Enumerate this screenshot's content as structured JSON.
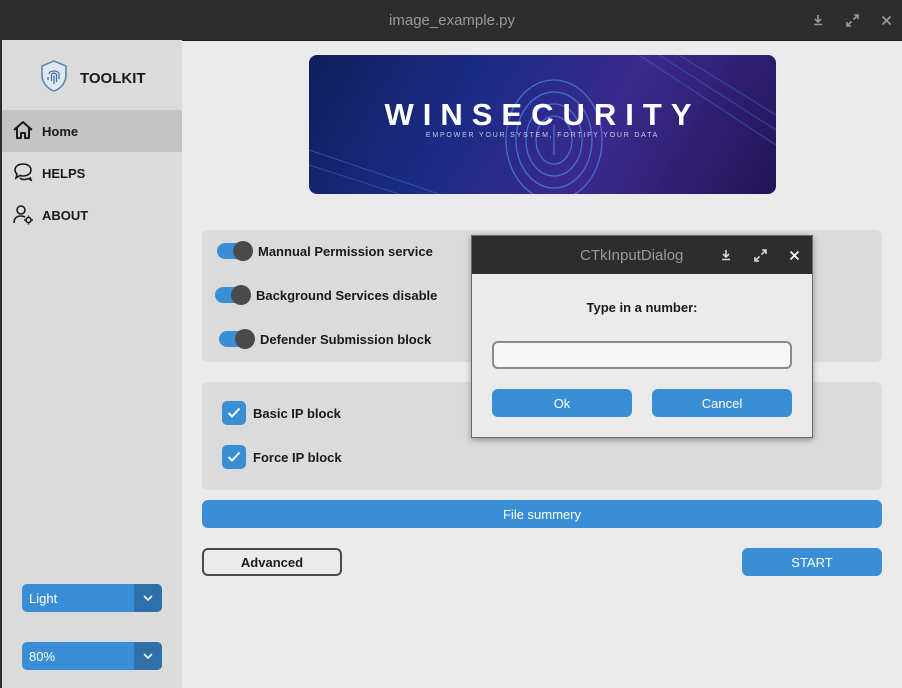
{
  "window": {
    "title": "image_example.py",
    "controls": [
      "minimize-icon",
      "maximize-icon",
      "close-icon"
    ]
  },
  "sidebar": {
    "logo_text": "TOOLKIT",
    "items": [
      {
        "label": "Home",
        "icon": "home-icon",
        "active": true
      },
      {
        "label": "HELPS",
        "icon": "chat-icon",
        "active": false
      },
      {
        "label": "ABOUT",
        "icon": "user-gear-icon",
        "active": false
      }
    ],
    "appearance_mode": "Light",
    "scaling": "80%"
  },
  "banner": {
    "title": "WINSECURITY",
    "subtitle": "EMPOWER YOUR SYSTEM, FORTIFY YOUR DATA"
  },
  "switches": [
    {
      "label": "Mannual Permission service",
      "on": true
    },
    {
      "label": "Background Services disable",
      "on": true
    },
    {
      "label": "Defender Submission block",
      "on": true
    }
  ],
  "checkboxes": [
    {
      "label": "Basic IP block",
      "checked": true
    },
    {
      "label": "Force IP block",
      "checked": true
    }
  ],
  "buttons": {
    "file_summary": "File summery",
    "advanced": "Advanced",
    "start": "START"
  },
  "dialog": {
    "title": "CTkInputDialog",
    "prompt": "Type in a number:",
    "input_value": "",
    "ok": "Ok",
    "cancel": "Cancel"
  },
  "colors": {
    "accent": "#3a8ed6",
    "titlebar": "#2d2d2d",
    "sidebar": "#dbdbdb",
    "background": "#ebebeb"
  }
}
